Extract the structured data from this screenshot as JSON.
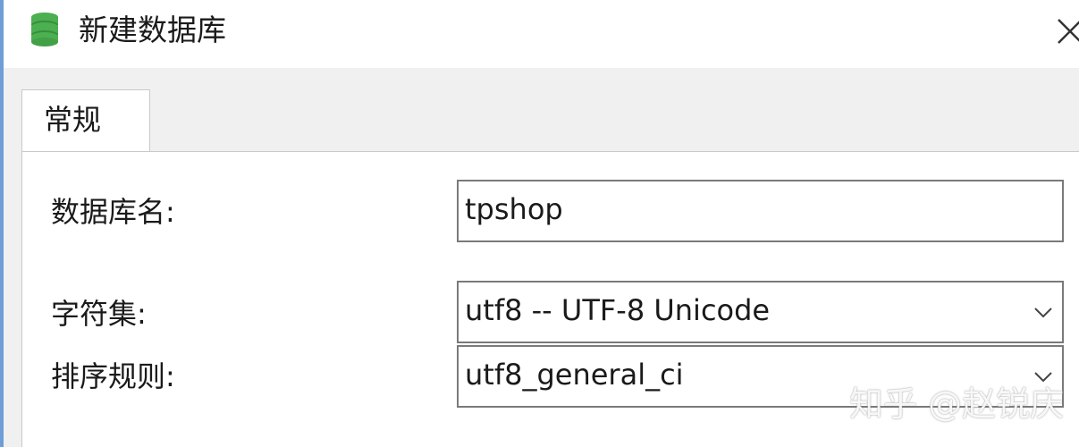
{
  "window": {
    "title": "新建数据库",
    "icon": "database-icon",
    "close_icon": "close-icon"
  },
  "tabs": [
    {
      "label": "常规",
      "selected": true
    }
  ],
  "form": {
    "db_name": {
      "label": "数据库名:",
      "value": "tpshop"
    },
    "charset": {
      "label": "字符集:",
      "value": "utf8 -- UTF-8 Unicode"
    },
    "collation": {
      "label": "排序规则:",
      "value": "utf8_general_ci"
    }
  },
  "watermark": {
    "text": "知乎 @赵锐庆"
  },
  "colors": {
    "accent_border": "#6e9ed6",
    "db_icon": "#4caf50"
  }
}
